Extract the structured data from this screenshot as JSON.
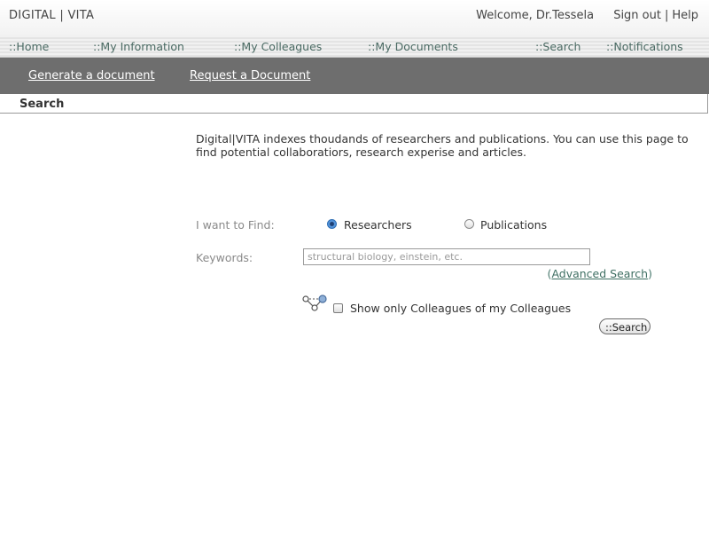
{
  "header": {
    "logo": "DIGITAL | VITA",
    "welcome": "Welcome, Dr.Tessela",
    "sign_out": "Sign out",
    "separator": "|",
    "help": "Help"
  },
  "nav": {
    "items": [
      {
        "label": "::Home"
      },
      {
        "label": "::My Information"
      },
      {
        "label": "::My Colleagues"
      },
      {
        "label": "::My Documents"
      },
      {
        "label": "::Search"
      },
      {
        "label": "::Notifications"
      }
    ]
  },
  "subnav": {
    "generate": "Generate a document",
    "request": "Request a Document"
  },
  "section": {
    "title": "Search"
  },
  "intro": "Digital|VITA indexes thoudands of researchers and publications. You can use this page to find potential collaboratiors, research experise and articles.",
  "form": {
    "find_label": "I want to Find:",
    "options": [
      {
        "label": "Researchers",
        "checked": true
      },
      {
        "label": "Publications",
        "checked": false
      }
    ],
    "keywords_label": "Keywords:",
    "keywords_placeholder": "structural biology, einstein, etc.",
    "keywords_value": "",
    "advanced_open": "(",
    "advanced_search": "Advanced Search",
    "advanced_close": ")",
    "colleague_filter_label": "Show only Colleagues of my Colleagues",
    "colleague_filter_checked": false,
    "search_button": "::Search"
  },
  "colors": {
    "nav_text": "#4a6a63",
    "subbar_bg": "#6e6e6e",
    "radio_selected": "#3d7fcf"
  }
}
